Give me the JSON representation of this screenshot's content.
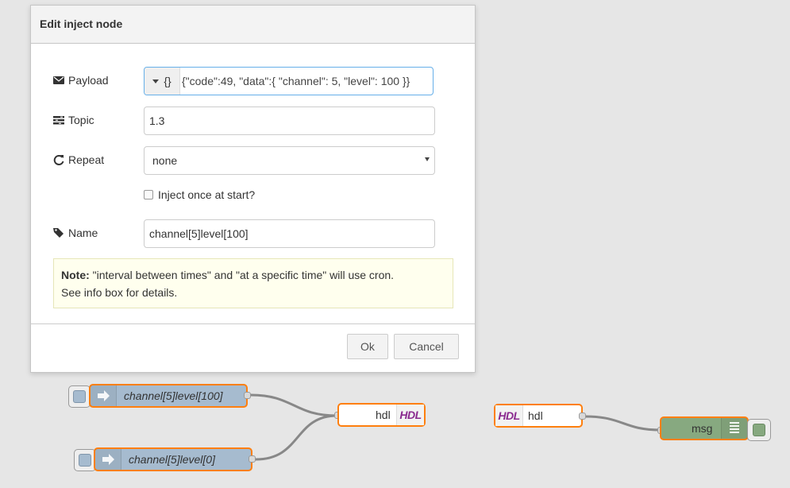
{
  "dialog": {
    "title": "Edit inject node",
    "payload": {
      "label": "Payload",
      "type_label": "{}",
      "value": "{\"code\":49, \"data\":{ \"channel\": 5, \"level\": 100 }}"
    },
    "topic": {
      "label": "Topic",
      "value": "1.3"
    },
    "repeat": {
      "label": "Repeat",
      "value": "none"
    },
    "inject_once": {
      "label": "Inject once at start?",
      "checked": false
    },
    "name": {
      "label": "Name",
      "value": "channel[5]level[100]"
    },
    "note": {
      "bold": "Note:",
      "line1": " \"interval between times\" and \"at a specific time\" will use cron.",
      "line2": "See info box for details."
    },
    "ok_label": "Ok",
    "cancel_label": "Cancel"
  },
  "flow": {
    "inject_node_1": "channel[5]level[100]",
    "inject_node_2": "channel[5]level[0]",
    "hdl_out_node": "hdl",
    "hdl_in_node": "hdl",
    "hdl_icon_text": "HDL",
    "debug_node": "msg",
    "colors": {
      "inject": "#a6bbcf",
      "hdl": "#ffffff",
      "debug": "#87a980",
      "selected_border": "#ff7f0e",
      "wire": "#888888"
    }
  }
}
